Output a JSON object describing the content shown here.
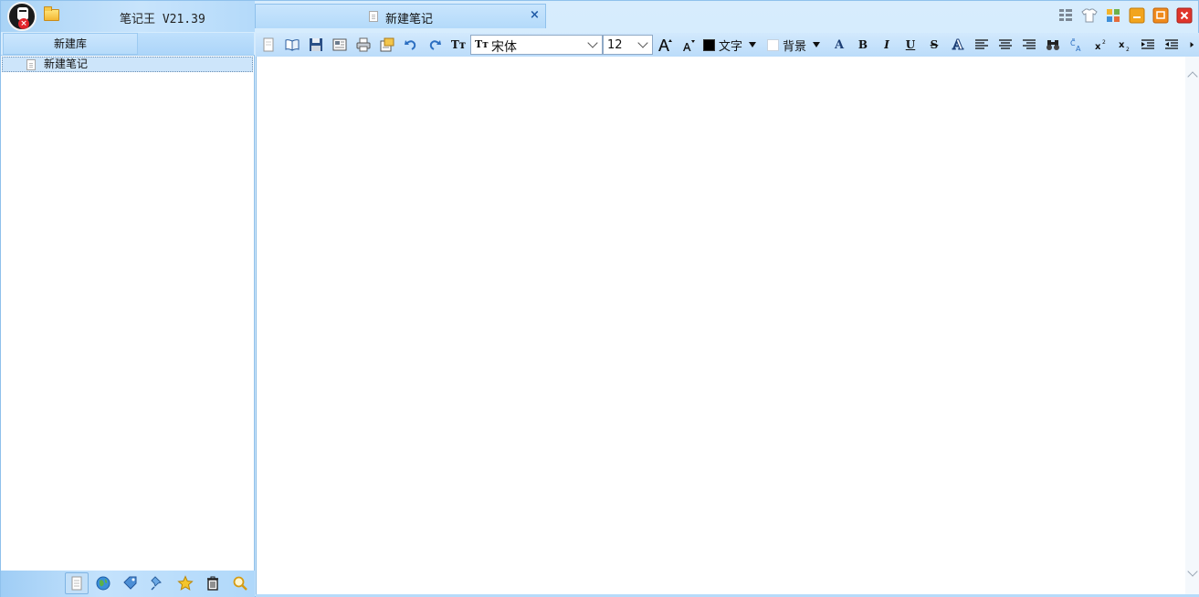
{
  "app": {
    "title": "笔记王 V21.39"
  },
  "library": {
    "tab_label": "新建库",
    "items": [
      {
        "label": "新建笔记",
        "selected": true
      }
    ]
  },
  "document": {
    "tab_label": "新建笔记",
    "close_glyph": "×"
  },
  "toolbar": {
    "font_icon_glyph": "Tт",
    "font_name": "宋体",
    "font_size": "12",
    "text_color_label": "文字",
    "text_color": "#000000",
    "bg_color_label": "背景",
    "bg_color": "#ffffff",
    "bold_glyph": "B",
    "italic_glyph": "I",
    "underline_glyph": "U",
    "strike_glyph": "S",
    "outline_glyph": "A"
  },
  "window_controls": [
    "layout-icon",
    "skin-icon",
    "grid-icon",
    "minimize-icon",
    "maximize-icon",
    "close-icon"
  ],
  "bottom_tools": [
    "note-icon",
    "globe-icon",
    "tag-icon",
    "pin-icon",
    "star-icon",
    "trash-icon",
    "search-icon"
  ],
  "colors": {
    "accent": "#2f7fd0",
    "panel": "#c5e2fb",
    "close_red": "#e0352b",
    "minimize_orange": "#f0a020"
  }
}
